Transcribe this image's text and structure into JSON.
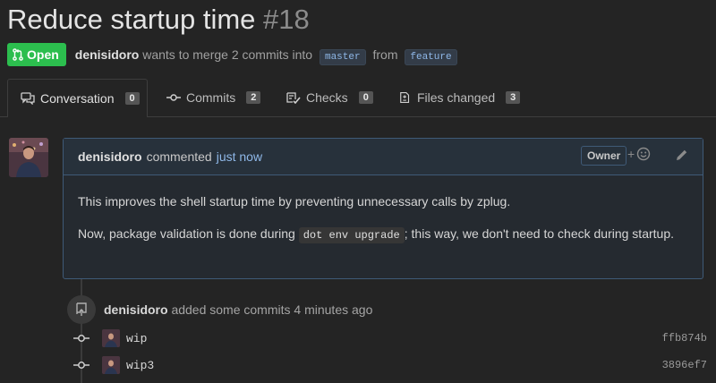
{
  "pr": {
    "title": "Reduce startup time",
    "number": "#18",
    "state": "Open",
    "author": "denisidoro",
    "merge_text": "wants to merge 2 commits into",
    "base_branch": "master",
    "from_text": "from",
    "head_branch": "feature"
  },
  "tabs": [
    {
      "label": "Conversation",
      "count": "0",
      "icon": "comment-discussion-icon",
      "active": true
    },
    {
      "label": "Commits",
      "count": "2",
      "icon": "git-commit-icon"
    },
    {
      "label": "Checks",
      "count": "0",
      "icon": "checklist-icon"
    },
    {
      "label": "Files changed",
      "count": "3",
      "icon": "file-diff-icon"
    }
  ],
  "comment": {
    "author": "denisidoro",
    "action": "commented",
    "time": "just now",
    "role": "Owner",
    "body_p1": "This improves the shell startup time by preventing unnecessary calls by zplug.",
    "body_p2_before": "Now, package validation is done during ",
    "body_p2_code": "dot env upgrade",
    "body_p2_after": "; this way, we don't need to check during startup."
  },
  "event": {
    "author": "denisidoro",
    "text": "added some commits",
    "time": "4 minutes ago"
  },
  "commits": [
    {
      "message": "wip",
      "sha": "ffb874b"
    },
    {
      "message": "wip3",
      "sha": "3896ef7"
    }
  ],
  "colors": {
    "background": "#242424",
    "open_badge": "#2cbe4e",
    "comment_border": "#3f5a77",
    "link": "#8fb8e8"
  }
}
